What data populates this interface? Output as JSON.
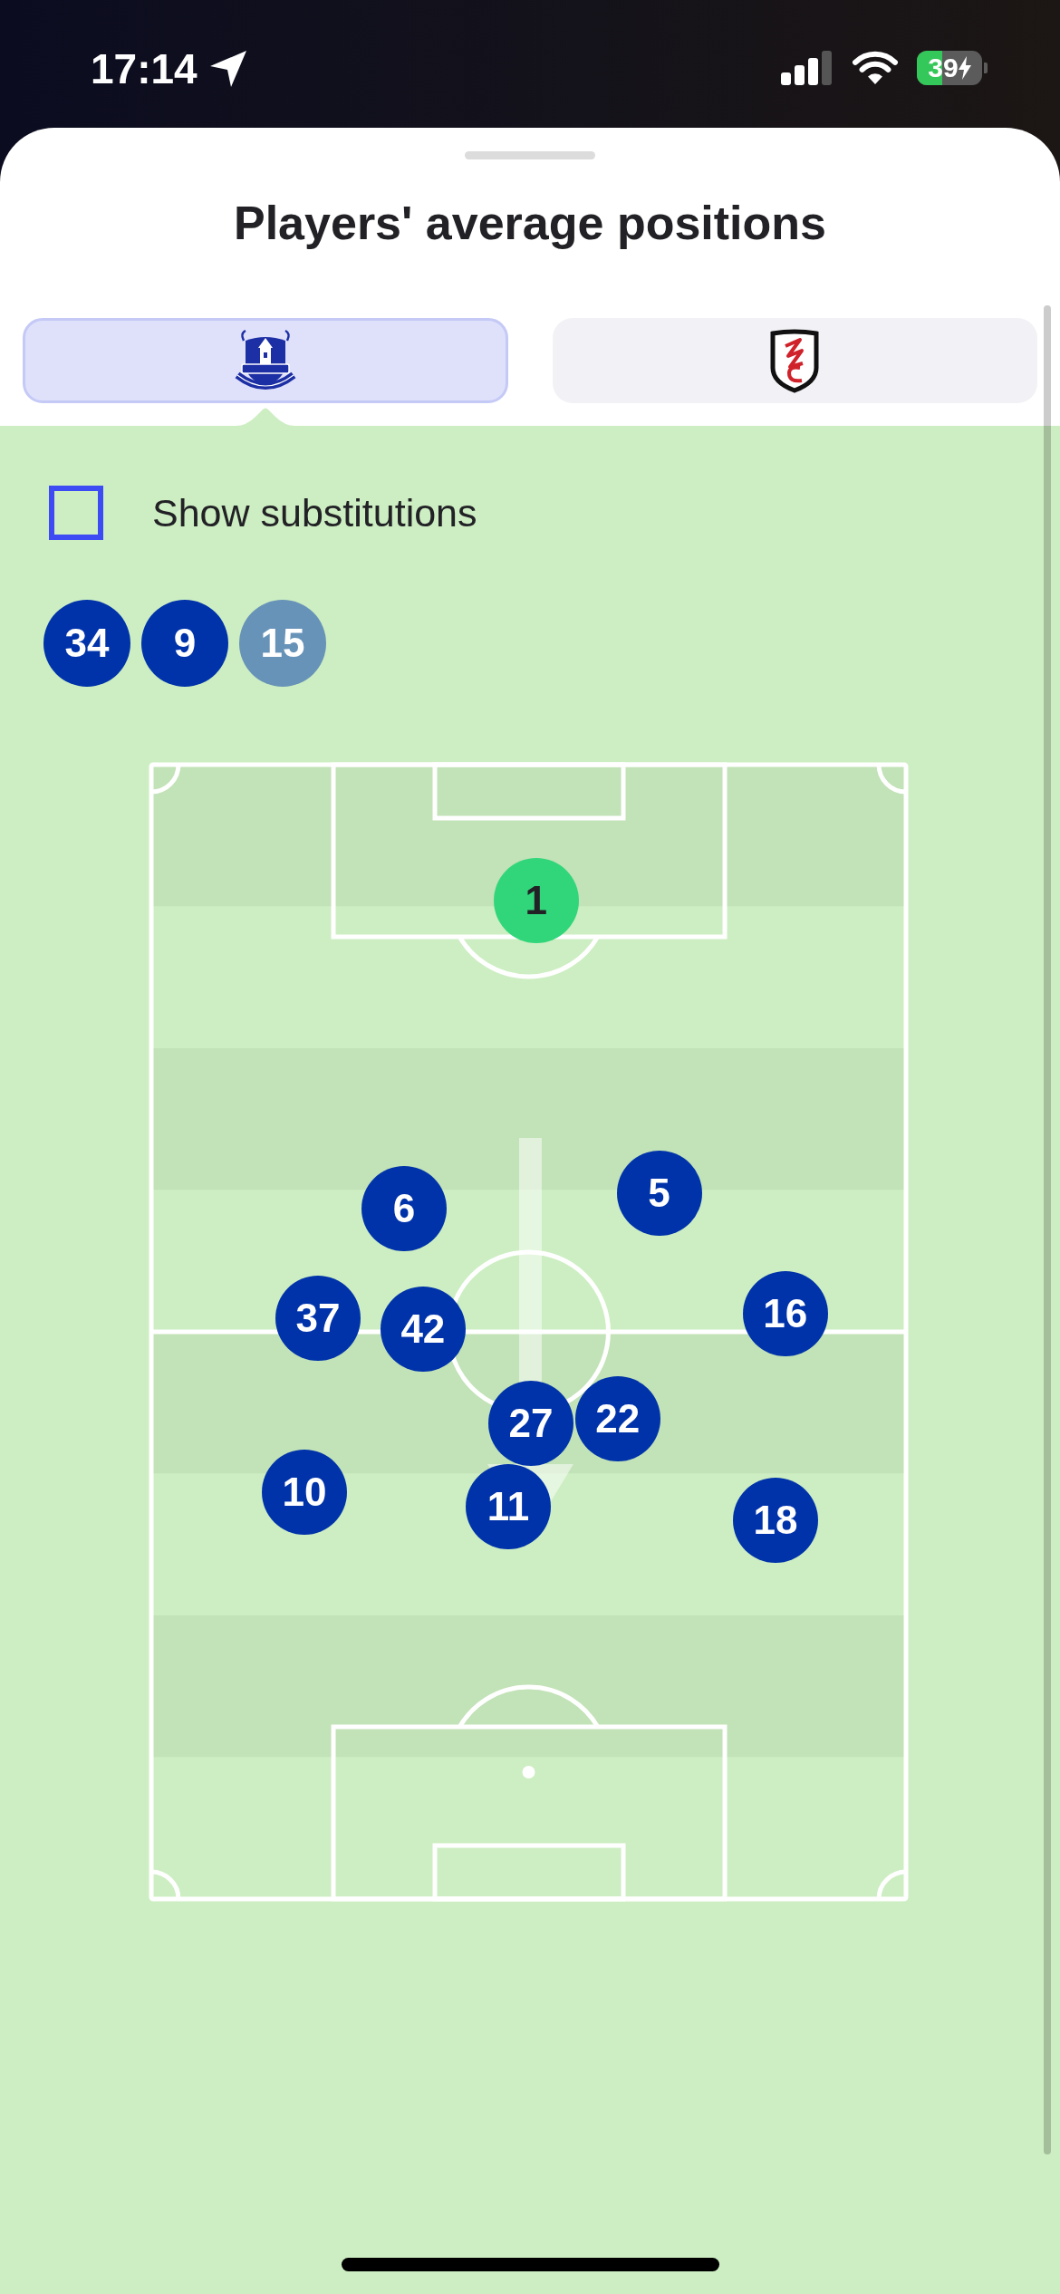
{
  "status_bar": {
    "time": "17:14",
    "battery": "39"
  },
  "title": "Players' average positions",
  "tabs": [
    {
      "kind": "everton",
      "selected": true
    },
    {
      "kind": "fulham",
      "selected": false
    }
  ],
  "substitutions_toggle": {
    "label": "Show substitutions",
    "checked": false
  },
  "substitutes": [
    {
      "number": "34",
      "dimmed": false
    },
    {
      "number": "9",
      "dimmed": false
    },
    {
      "number": "15",
      "dimmed": true
    }
  ],
  "players": [
    {
      "number": "1",
      "kind": "goalkeeper"
    },
    {
      "number": "6",
      "kind": "outfield"
    },
    {
      "number": "5",
      "kind": "outfield"
    },
    {
      "number": "37",
      "kind": "outfield"
    },
    {
      "number": "42",
      "kind": "outfield"
    },
    {
      "number": "16",
      "kind": "outfield"
    },
    {
      "number": "27",
      "kind": "outfield"
    },
    {
      "number": "22",
      "kind": "outfield"
    },
    {
      "number": "10",
      "kind": "outfield"
    },
    {
      "number": "11",
      "kind": "outfield"
    },
    {
      "number": "18",
      "kind": "outfield"
    }
  ]
}
